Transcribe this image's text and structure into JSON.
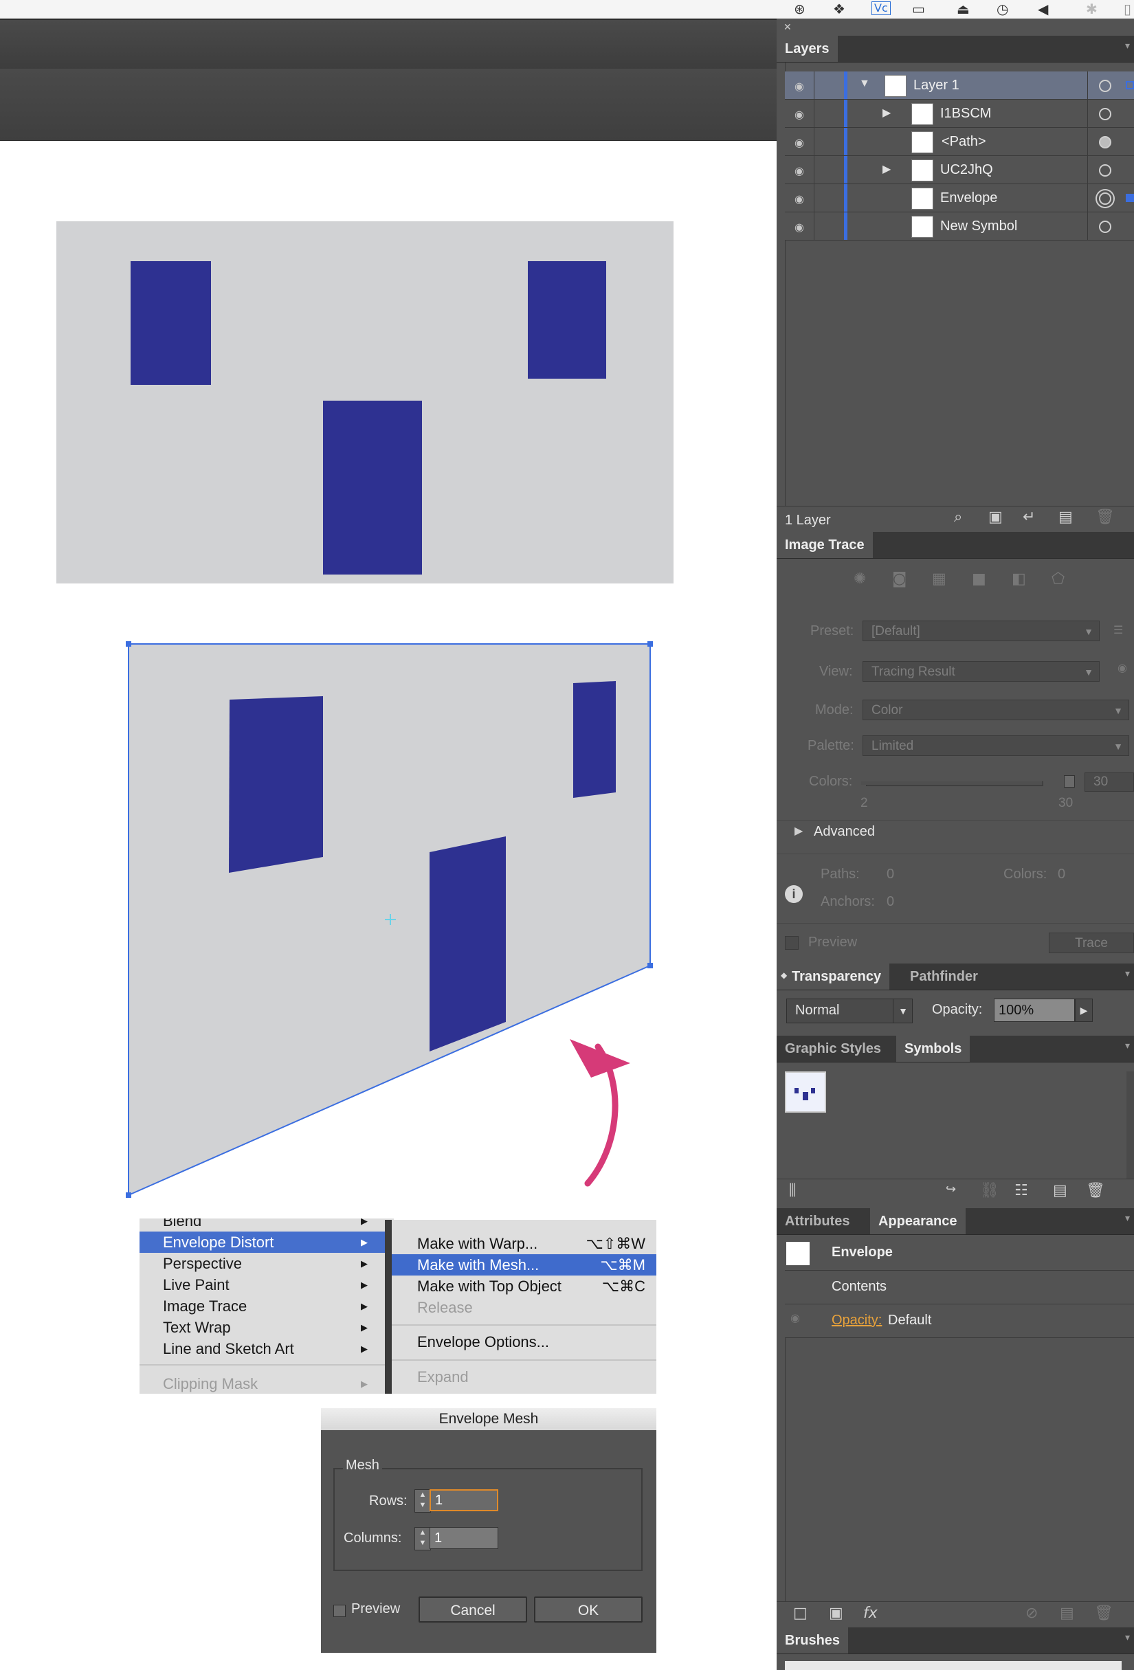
{
  "layers_panel": {
    "tab": "Layers",
    "rows": [
      {
        "name": "Layer 1"
      },
      {
        "name": "I1BSCM"
      },
      {
        "name": "<Path>"
      },
      {
        "name": "UC2JhQ"
      },
      {
        "name": "Envelope"
      },
      {
        "name": "New Symbol"
      }
    ],
    "footer": "1 Layer"
  },
  "image_trace_panel": {
    "tab": "Image Trace",
    "preset_label": "Preset:",
    "preset_value": "[Default]",
    "view_label": "View:",
    "view_value": "Tracing Result",
    "mode_label": "Mode:",
    "mode_value": "Color",
    "palette_label": "Palette:",
    "palette_value": "Limited",
    "colors_label": "Colors:",
    "colors_value": "30",
    "slider_min": "2",
    "slider_max": "30",
    "advanced": "Advanced",
    "paths_label": "Paths:",
    "paths_value": "0",
    "colors_count_label": "Colors:",
    "colors_count_value": "0",
    "anchors_label": "Anchors:",
    "anchors_value": "0",
    "preview": "Preview",
    "trace_button": "Trace"
  },
  "transparency_panel": {
    "tab1": "Transparency",
    "tab2": "Pathfinder",
    "blend_mode": "Normal",
    "opacity_label": "Opacity:",
    "opacity_value": "100%"
  },
  "symbols_panel": {
    "tab1": "Graphic Styles",
    "tab2": "Symbols"
  },
  "appearance_panel": {
    "tab1": "Attributes",
    "tab2": "Appearance",
    "item": "Envelope",
    "contents": "Contents",
    "opacity_link": "Opacity:",
    "opacity_value": "Default"
  },
  "brushes_panel": {
    "tab": "Brushes"
  },
  "object_menu": {
    "items": [
      {
        "label": "Blend"
      },
      {
        "label": "Envelope Distort"
      },
      {
        "label": "Perspective"
      },
      {
        "label": "Live Paint"
      },
      {
        "label": "Image Trace"
      },
      {
        "label": "Text Wrap"
      },
      {
        "label": "Line and Sketch Art"
      },
      {
        "label": "Clipping Mask"
      }
    ]
  },
  "envelope_submenu": {
    "items": [
      {
        "label": "Make with Warp...",
        "shortcut": "⌥⇧⌘W"
      },
      {
        "label": "Make with Mesh...",
        "shortcut": "⌥⌘M"
      },
      {
        "label": "Make with Top Object",
        "shortcut": "⌥⌘C"
      },
      {
        "label": "Release",
        "shortcut": ""
      },
      {
        "label": "Envelope Options...",
        "shortcut": ""
      },
      {
        "label": "Expand",
        "shortcut": ""
      }
    ]
  },
  "envelope_mesh_dialog": {
    "title": "Envelope Mesh",
    "group": "Mesh",
    "rows_label": "Rows:",
    "rows_value": "1",
    "columns_label": "Columns:",
    "columns_value": "1",
    "preview_label": "Preview",
    "cancel": "Cancel",
    "ok": "OK"
  },
  "colors": {
    "artwork_fill": "#2e3191",
    "artwork_bg": "#d1d2d4",
    "selection": "#3b6ee0",
    "arrow": "#d63a78",
    "menu_highlight": "#3f6bcc"
  }
}
